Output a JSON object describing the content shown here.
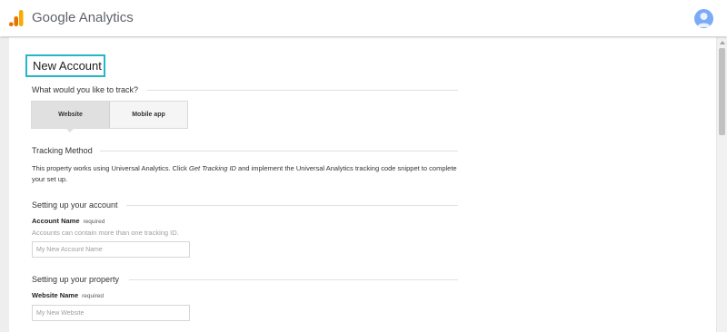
{
  "header": {
    "brand": "Google Analytics",
    "logo_icon": "analytics-logo-icon",
    "avatar_icon": "account-avatar-icon",
    "logo_colors": [
      "#f9ab00",
      "#e37400"
    ],
    "avatar_color": "#7baaf7"
  },
  "page": {
    "title": "New Account",
    "track_question": "What would you like to track?",
    "track_options": {
      "website": "Website",
      "mobile_app": "Mobile app",
      "selected": "Website"
    },
    "tracking_method": {
      "heading": "Tracking Method",
      "text_before": "This property works using Universal Analytics. Click ",
      "link_text": "Get Tracking ID",
      "text_after": " and implement the Universal Analytics tracking code snippet to complete your set up."
    },
    "account_section": {
      "heading": "Setting up your account",
      "field_label": "Account Name",
      "required": "required",
      "hint": "Accounts can contain more than one tracking ID.",
      "placeholder": "My New Account Name",
      "value": ""
    },
    "property_section": {
      "heading": "Setting up your property",
      "field_label": "Website Name",
      "required": "required",
      "placeholder": "My New Website",
      "value": ""
    },
    "highlight_color": "#26b5c9"
  }
}
